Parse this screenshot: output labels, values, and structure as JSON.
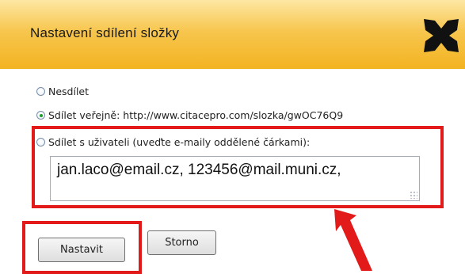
{
  "dialog": {
    "title": "Nastavení sdílení složky",
    "close_icon": "close-x-icon"
  },
  "options": [
    {
      "label": "Nesdílet",
      "checked": false
    },
    {
      "label": "Sdílet veřejně: http://www.citacepro.com/slozka/gwOC76Q9",
      "checked": true
    },
    {
      "label": "Sdílet s uživateli (uveďte e-maily oddělené čárkami):",
      "checked": false
    }
  ],
  "emails": {
    "value": "jan.laco@email.cz, 123456@mail.muni.cz,"
  },
  "buttons": {
    "submit_label": "Nastavit",
    "cancel_label": "Storno"
  },
  "annotations": {
    "highlight_color": "#e21a1a",
    "arrow_icon": "red-arrow-icon"
  },
  "colors": {
    "header_top": "#fde7a3",
    "header_bottom": "#f3b321",
    "selected_radio": "#1d9c29"
  }
}
